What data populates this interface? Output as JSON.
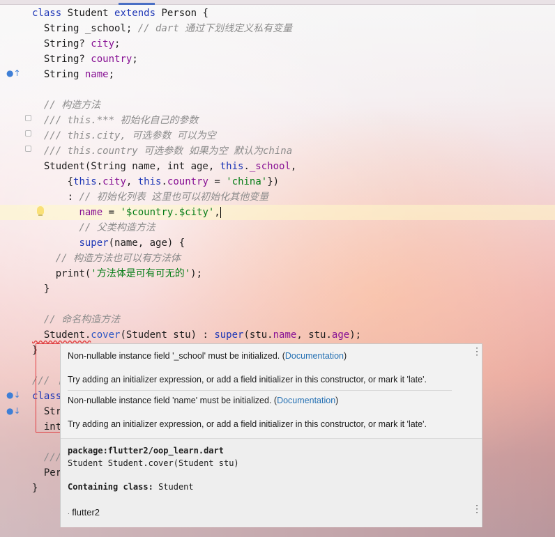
{
  "editor": {
    "lines": [
      {
        "segments": [
          {
            "t": "class ",
            "c": "kw"
          },
          {
            "t": "Student ",
            "c": "ty"
          },
          {
            "t": "extends ",
            "c": "kw"
          },
          {
            "t": "Person {",
            "c": "ty"
          }
        ]
      },
      {
        "segments": [
          {
            "t": "  String _school; ",
            "c": "ty"
          },
          {
            "t": "// dart 通过下划线定义私有变量",
            "c": "cm"
          }
        ]
      },
      {
        "segments": [
          {
            "t": "  String? ",
            "c": "ty"
          },
          {
            "t": "city",
            "c": "fld"
          },
          {
            "t": ";",
            "c": "ty"
          }
        ]
      },
      {
        "segments": [
          {
            "t": "  String? ",
            "c": "ty"
          },
          {
            "t": "country",
            "c": "fld"
          },
          {
            "t": ";",
            "c": "ty"
          }
        ]
      },
      {
        "segments": [
          {
            "t": "  String ",
            "c": "ty"
          },
          {
            "t": "name",
            "c": "fld"
          },
          {
            "t": ";",
            "c": "ty"
          }
        ]
      },
      {
        "segments": []
      },
      {
        "segments": [
          {
            "t": "  // 构造方法",
            "c": "cm"
          }
        ]
      },
      {
        "segments": [
          {
            "t": "  /// this.*** 初始化自己的参数",
            "c": "cm"
          }
        ]
      },
      {
        "segments": [
          {
            "t": "  /// this.city, 可选参数 可以为空",
            "c": "cm"
          }
        ]
      },
      {
        "segments": [
          {
            "t": "  /// this.country 可选参数 如果为空 默认为china",
            "c": "cm"
          }
        ]
      },
      {
        "segments": [
          {
            "t": "  Student(String name, int age, ",
            "c": "ty"
          },
          {
            "t": "this",
            "c": "kw"
          },
          {
            "t": ".",
            "c": "ty"
          },
          {
            "t": "_school",
            "c": "fld"
          },
          {
            "t": ",",
            "c": "ty"
          }
        ]
      },
      {
        "segments": [
          {
            "t": "      {",
            "c": "ty"
          },
          {
            "t": "this",
            "c": "kw"
          },
          {
            "t": ".",
            "c": "ty"
          },
          {
            "t": "city",
            "c": "fld"
          },
          {
            "t": ", ",
            "c": "ty"
          },
          {
            "t": "this",
            "c": "kw"
          },
          {
            "t": ".",
            "c": "ty"
          },
          {
            "t": "country",
            "c": "fld"
          },
          {
            "t": " = ",
            "c": "ty"
          },
          {
            "t": "'china'",
            "c": "str"
          },
          {
            "t": "})",
            "c": "ty"
          }
        ]
      },
      {
        "segments": [
          {
            "t": "      : ",
            "c": "ty"
          },
          {
            "t": "// 初始化列表 这里也可以初始化其他变量",
            "c": "cm"
          }
        ]
      },
      {
        "segments": [
          {
            "t": "        ",
            "c": "ty"
          },
          {
            "t": "name",
            "c": "fld"
          },
          {
            "t": " = ",
            "c": "ty"
          },
          {
            "t": "'$country.$city'",
            "c": "str"
          },
          {
            "t": ",",
            "c": "ty"
          }
        ],
        "caret": true,
        "highlight": true
      },
      {
        "segments": [
          {
            "t": "        // 父类构造方法",
            "c": "cm"
          }
        ]
      },
      {
        "segments": [
          {
            "t": "        ",
            "c": "ty"
          },
          {
            "t": "super",
            "c": "kw"
          },
          {
            "t": "(name, age) {",
            "c": "ty"
          }
        ]
      },
      {
        "segments": [
          {
            "t": "    // 构造方法也可以有方法体",
            "c": "cm"
          }
        ]
      },
      {
        "segments": [
          {
            "t": "    print(",
            "c": "ty"
          },
          {
            "t": "'方法体是可有可无的'",
            "c": "str"
          },
          {
            "t": ");",
            "c": "ty"
          }
        ]
      },
      {
        "segments": [
          {
            "t": "  }",
            "c": "ty"
          }
        ]
      },
      {
        "segments": []
      },
      {
        "segments": [
          {
            "t": "  // 命名构造方法",
            "c": "cm"
          }
        ]
      },
      {
        "segments": [
          {
            "t": "  Student.",
            "c": "ty"
          },
          {
            "t": "cover",
            "c": "fn"
          },
          {
            "t": "(Student stu) : ",
            "c": "ty"
          },
          {
            "t": "super",
            "c": "kw"
          },
          {
            "t": "(stu.",
            "c": "ty"
          },
          {
            "t": "name",
            "c": "fld"
          },
          {
            "t": ", stu.",
            "c": "ty"
          },
          {
            "t": "age",
            "c": "fld"
          },
          {
            "t": ");",
            "c": "ty"
          }
        ]
      },
      {
        "segments": [
          {
            "t": "}",
            "c": "ty"
          }
        ]
      },
      {
        "segments": []
      },
      {
        "segments": [
          {
            "t": "/// 卜",
            "c": "cm"
          }
        ]
      },
      {
        "segments": [
          {
            "t": "class",
            "c": "kw"
          }
        ]
      },
      {
        "segments": [
          {
            "t": "  Str",
            "c": "ty"
          }
        ]
      },
      {
        "segments": [
          {
            "t": "  int",
            "c": "ty"
          }
        ]
      },
      {
        "segments": []
      },
      {
        "segments": [
          {
            "t": "  ///",
            "c": "cm"
          }
        ]
      },
      {
        "segments": [
          {
            "t": "  Per",
            "c": "ty"
          }
        ]
      },
      {
        "segments": [
          {
            "t": "}",
            "c": "ty"
          }
        ]
      }
    ]
  },
  "popup": {
    "error1_text": "Non-nullable instance field '_school' must be initialized. (",
    "error1_link": "Documentation",
    "error1_close": ")",
    "error1_hint": "Try adding an initializer expression, or add a field initializer in this constructor, or mark it 'late'.",
    "error2_text": "Non-nullable instance field 'name' must be initialized. (",
    "error2_link": "Documentation",
    "error2_close": ")",
    "error2_hint": "Try adding an initializer expression, or add a field initializer in this constructor, or mark it 'late'.",
    "doc_package": "package:flutter2/oop_learn.dart",
    "doc_signature": "Student Student.cover(Student stu)",
    "doc_class_label": "Containing class:",
    "doc_class_value": "Student",
    "footer_module": "flutter2",
    "kebab_icon": "⋮"
  }
}
